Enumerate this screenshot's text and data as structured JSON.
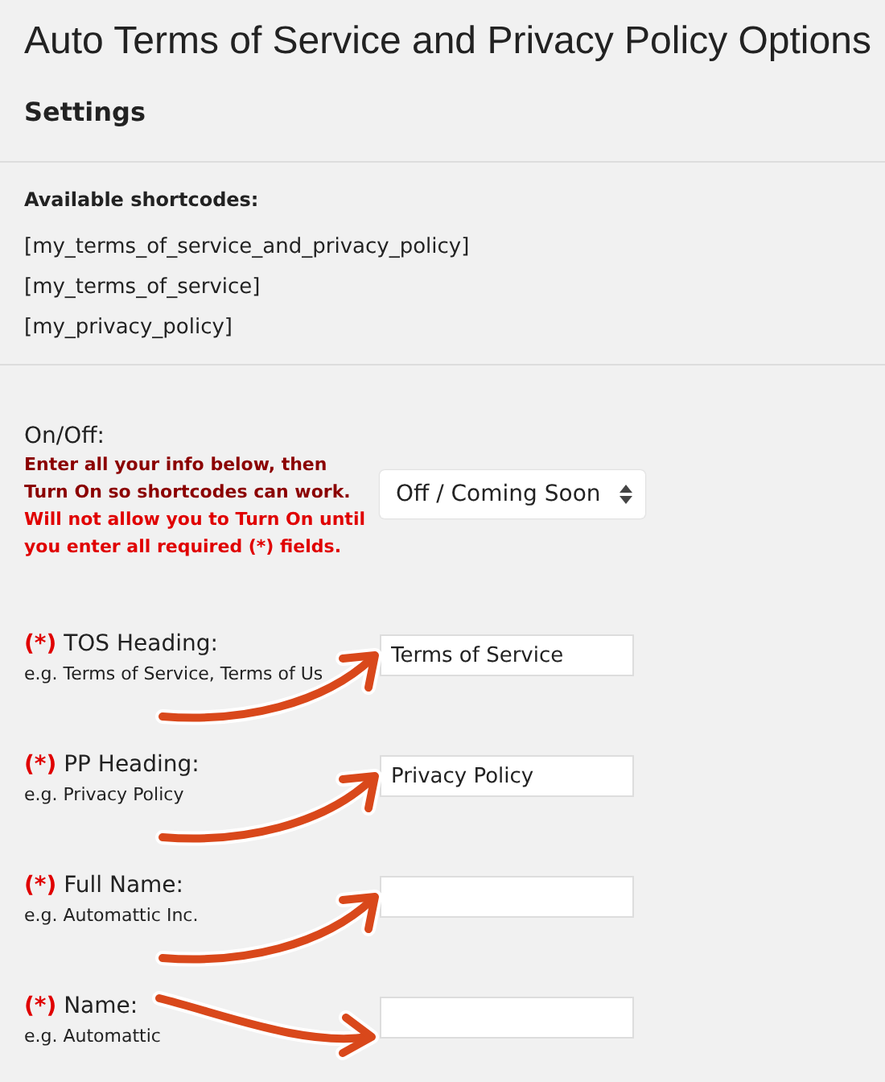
{
  "title": "Auto Terms of Service and Privacy Policy Options",
  "section": "Settings",
  "shortcodes": {
    "label": "Available shortcodes:",
    "items": [
      "[my_terms_of_service_and_privacy_policy]",
      "[my_terms_of_service]",
      "[my_privacy_policy]"
    ]
  },
  "on_off": {
    "label": "On/Off:",
    "notes": [
      {
        "kind": "info",
        "text": "Enter all your info below, then Turn On so shortcodes can work."
      },
      {
        "kind": "warning",
        "text": "Will not allow you to Turn On until you enter all required (*) fields."
      }
    ],
    "select": "Off / Coming Soon"
  },
  "fields": [
    {
      "marker": "(*)",
      "label": "TOS Heading:",
      "hint": "e.g. Terms of Service, Terms of Us",
      "value": "Terms of Service",
      "kind": "up"
    },
    {
      "marker": "(*)",
      "label": "PP Heading:",
      "hint": "e.g. Privacy Policy",
      "value": "Privacy Policy",
      "kind": "up"
    },
    {
      "marker": "(*)",
      "label": "Full Name:",
      "hint": "e.g. Automattic Inc.",
      "kind": "up"
    },
    {
      "marker": "(*)",
      "label": "Name:",
      "hint": "e.g. Automattic",
      "kind": "down"
    }
  ]
}
